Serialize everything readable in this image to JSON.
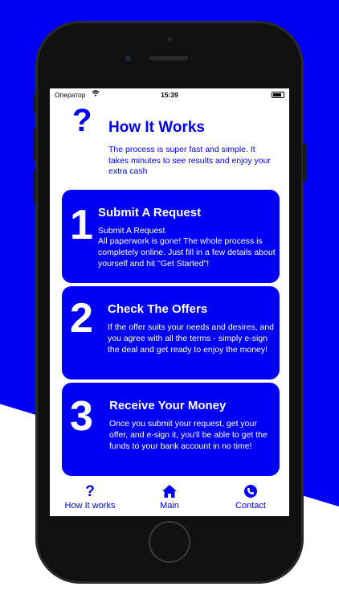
{
  "status_bar": {
    "operator": "Оператор",
    "time": "15:39"
  },
  "header": {
    "icon": "question-mark-icon",
    "icon_glyph": "?",
    "title": "How It Works",
    "subtitle": "The process is super fast and simple. It takes minutes to see results and enjoy your extra cash"
  },
  "steps": [
    {
      "number": "1",
      "title": "Submit A Request",
      "subtitle": "Submit A Request",
      "text": "All paperwork is gone! The whole process is completely online. Just fill in a few details about yourself and hit \"Get Started\"!"
    },
    {
      "number": "2",
      "title": "Check The Offers",
      "text": "If the offer suits your needs and desires, and you agree with all the terms - simply e-sign the deal and get ready to enjoy the money!"
    },
    {
      "number": "3",
      "title": "Receive Your Money",
      "text": "Once you submit your request, get your offer, and e-sign it, you'll be able to get the funds to your bank account in no time!"
    }
  ],
  "tabs": [
    {
      "label": "How It works",
      "icon": "question-mark-icon"
    },
    {
      "label": "Main",
      "icon": "home-icon"
    },
    {
      "label": "Contact",
      "icon": "phone-icon"
    }
  ],
  "colors": {
    "accent": "#0000f5",
    "background": "#ffffff"
  }
}
